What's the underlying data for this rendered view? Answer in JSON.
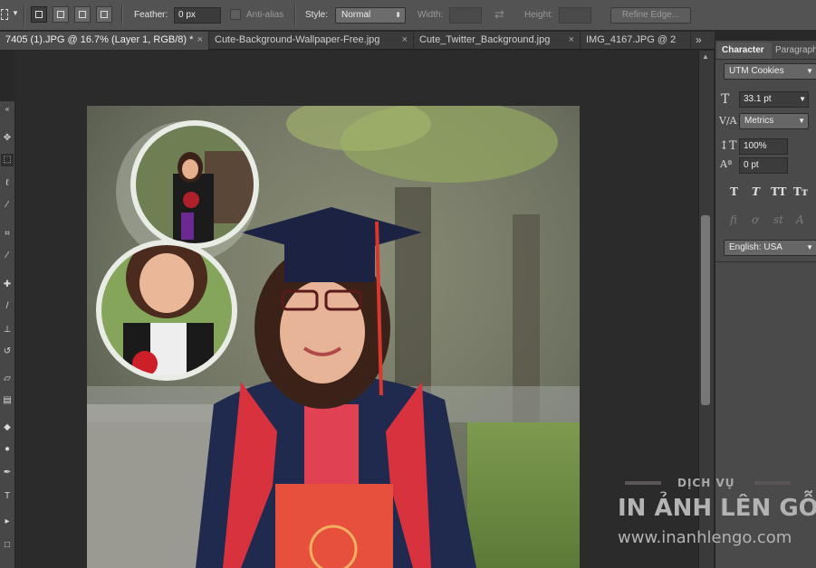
{
  "options_bar": {
    "feather_label": "Feather:",
    "feather_value": "0 px",
    "antialias_label": "Anti-alias",
    "style_label": "Style:",
    "style_value": "Normal",
    "width_label": "Width:",
    "height_label": "Height:",
    "refine_edge_label": "Refine Edge..."
  },
  "tabs": [
    {
      "label": "7405 (1).JPG @ 16.7% (Layer 1, RGB/8) *",
      "close": "×"
    },
    {
      "label": "Cute-Background-Wallpaper-Free.jpg",
      "close": "×"
    },
    {
      "label": "Cute_Twitter_Background.jpg",
      "close": "×"
    },
    {
      "label": "IMG_4167.JPG @ 2",
      "close": "×"
    }
  ],
  "tab_overflow": "»",
  "panel": {
    "tabs": [
      "Character",
      "Paragraph"
    ],
    "font_family": "UTM Cookies",
    "font_size": "33.1 pt",
    "kerning": "Metrics",
    "vertical_scale": "100%",
    "baseline_shift": "0 pt",
    "language": "English: USA",
    "style_buttons": [
      "T",
      "T",
      "TT",
      "Tт"
    ],
    "opentype_buttons": [
      "fi",
      "ơ",
      "st",
      "A"
    ]
  },
  "watermark": {
    "line1": "DỊCH VỤ",
    "line2": "IN ẢNH LÊN GỖ",
    "line3": "www.inanhlengo.com"
  },
  "colors": {
    "ui_bg": "#535353",
    "panel_bg": "#4a4a4a",
    "canvas_bg": "#2b2b2b",
    "gown_navy": "#1f2a4e",
    "gown_red": "#d8323f",
    "diploma_red": "#e8503e",
    "watermark_grey": "#b3b3b3"
  }
}
